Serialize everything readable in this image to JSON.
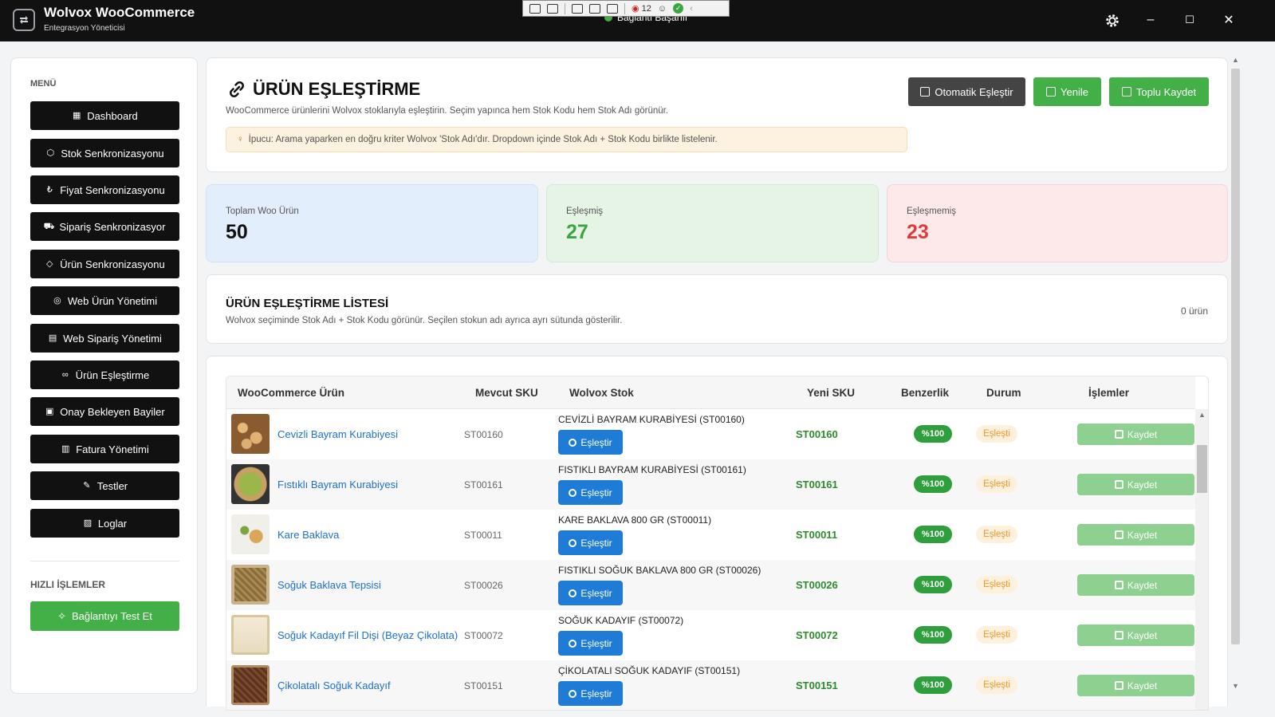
{
  "window": {
    "title": "Wolvox WooCommerce",
    "subtitle": "Entegrasyon Yöneticisi",
    "connection_status": "Bağlantı Başarılı",
    "debug_counter": "12",
    "minimize": "–",
    "maximize": "☐",
    "close": "✕"
  },
  "sidebar": {
    "menu_label": "MENÜ",
    "items": [
      {
        "label": "Dashboard",
        "icon": "chart-icon"
      },
      {
        "label": "Stok Senkronizasyonu",
        "icon": "box-icon"
      },
      {
        "label": "Fiyat Senkronizasyonu",
        "icon": "money-bag-icon"
      },
      {
        "label": "Sipariş Senkronizasyor",
        "icon": "cart-icon"
      },
      {
        "label": "Ürün Senkronizasyonu",
        "icon": "tag-icon"
      },
      {
        "label": "Web Ürün Yönetimi",
        "icon": "globe-icon"
      },
      {
        "label": "Web Sipariş Yönetimi",
        "icon": "truck-icon"
      },
      {
        "label": "Ürün Eşleştirme",
        "icon": "link-icon"
      },
      {
        "label": "Onay Bekleyen Bayiler",
        "icon": "store-icon"
      },
      {
        "label": "Fatura Yönetimi",
        "icon": "receipt-icon"
      },
      {
        "label": "Testler",
        "icon": "pencil-icon"
      },
      {
        "label": "Loglar",
        "icon": "log-icon"
      }
    ],
    "quick_label": "HIZLI İŞLEMLER",
    "test_button": "Bağlantıyı Test Et"
  },
  "header": {
    "title": "ÜRÜN EŞLEŞTİRME",
    "description": "WooCommerce ürünlerini Wolvox stoklarıyla eşleştirin. Seçim yapınca hem Stok Kodu hem Stok Adı görünür.",
    "tip": "İpucu: Arama yaparken en doğru kriter Wolvox 'Stok Adı'dır. Dropdown içinde Stok Adı + Stok Kodu birlikte listelenir.",
    "buttons": {
      "auto": "Otomatik Eşleştir",
      "refresh": "Yenile",
      "bulk_save": "Toplu Kaydet"
    }
  },
  "stats": {
    "total": {
      "label": "Toplam Woo Ürün",
      "value": "50"
    },
    "matched": {
      "label": "Eşleşmiş",
      "value": "27"
    },
    "unmatched": {
      "label": "Eşleşmemiş",
      "value": "23"
    }
  },
  "list": {
    "title": "ÜRÜN EŞLEŞTİRME LİSTESİ",
    "description": "Wolvox seçiminde Stok Adı + Stok Kodu görünür. Seçilen stokun adı ayrıca ayrı sütunda gösterilir.",
    "count": "0 ürün"
  },
  "table": {
    "headers": [
      "WooCommerce Ürün",
      "Mevcut SKU",
      "Wolvox Stok",
      "Yeni SKU",
      "Benzerlik",
      "Durum",
      "İşlemler"
    ],
    "match_label": "Eşleştir",
    "save_label": "Kaydet",
    "rows": [
      {
        "name": "Cevizli Bayram Kurabiyesi",
        "sku": "ST00160",
        "wolvox": "CEVİZLİ BAYRAM KURABİYESİ (ST00160)",
        "new_sku": "ST00160",
        "similarity": "%100",
        "status": "Eşleşti"
      },
      {
        "name": "Fıstıklı Bayram Kurabiyesi",
        "sku": "ST00161",
        "wolvox": "FISTIKLI BAYRAM KURABİYESİ (ST00161)",
        "new_sku": "ST00161",
        "similarity": "%100",
        "status": "Eşleşti"
      },
      {
        "name": "Kare Baklava",
        "sku": "ST00011",
        "wolvox": "KARE BAKLAVA 800 GR (ST00011)",
        "new_sku": "ST00011",
        "similarity": "%100",
        "status": "Eşleşti"
      },
      {
        "name": "Soğuk Baklava Tepsisi",
        "sku": "ST00026",
        "wolvox": "FISTIKLI SOĞUK BAKLAVA 800 GR (ST00026)",
        "new_sku": "ST00026",
        "similarity": "%100",
        "status": "Eşleşti"
      },
      {
        "name": "Soğuk Kadayıf Fil Dişi (Beyaz Çikolata)",
        "sku": "ST00072",
        "wolvox": "SOĞUK KADAYIF (ST00072)",
        "new_sku": "ST00072",
        "similarity": "%100",
        "status": "Eşleşti"
      },
      {
        "name": "Çikolatalı Soğuk Kadayıf",
        "sku": "ST00151",
        "wolvox": "ÇİKOLATALI SOĞUK KADAYIF (ST00151)",
        "new_sku": "ST00151",
        "similarity": "%100",
        "status": "Eşleşti"
      }
    ]
  },
  "colors": {
    "titlebar": "#111111",
    "menu_button": "#111111",
    "green": "#43b047",
    "blue": "#1e7bd6",
    "link": "#1f6fcc",
    "matched_value": "#3aa640",
    "unmatched_value": "#e03a3a"
  }
}
